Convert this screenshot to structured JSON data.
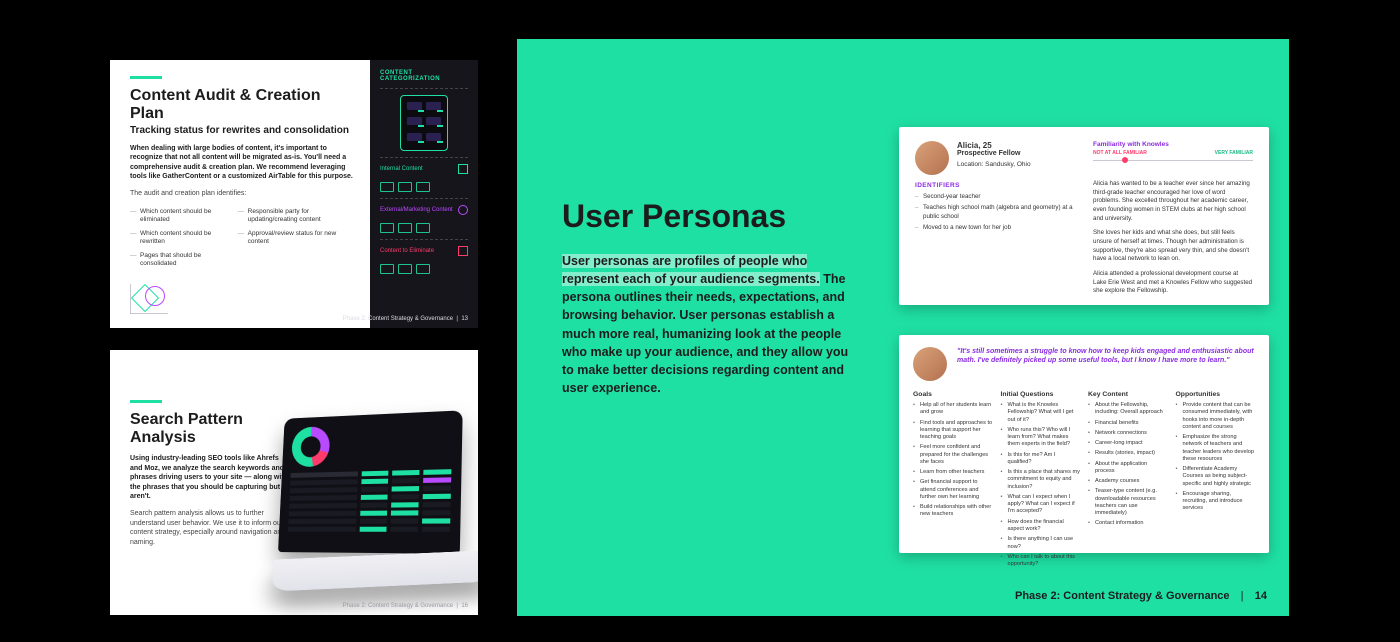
{
  "audit": {
    "title": "Content Audit & Creation Plan",
    "subtitle": "Tracking status for rewrites and consolidation",
    "lead": "When dealing with large bodies of content, it's important to recognize that not all content will be migrated as-is. You'll need a comprehensive audit & creation plan. We recommend leveraging tools like GatherContent or a customized AirTable for this purpose.",
    "intro": "The audit and creation plan identifies:",
    "col1": [
      "Which content should be eliminated",
      "Which content should be rewritten",
      "Pages that should be consolidated"
    ],
    "col2": [
      "Responsible party for updating/creating content",
      "Approval/review status for new content"
    ],
    "cat_title": "CONTENT CATEGORIZATION",
    "rows": {
      "internal": "Internal Content",
      "external": "External/Marketing Content",
      "eliminate": "Content to Eliminate"
    },
    "footer_phase": "Phase 2: Content Strategy & Governance",
    "footer_page": "13"
  },
  "search": {
    "title": "Search Pattern Analysis",
    "lead": "Using industry-leading SEO tools like Ahrefs and Moz, we analyze the search keywords and phrases driving users to your site — along with the phrases that you should be capturing but aren't.",
    "more": "Search pattern analysis allows us to further understand user behavior. We use it to inform our content strategy, especially around navigation and naming.",
    "footer_phase": "Phase 2: Content Strategy & Governance",
    "footer_page": "16"
  },
  "personas": {
    "title": "User Personas",
    "body_hl": "User personas are profiles of people who represent each of your audience segments.",
    "body_rest": " The persona outlines their needs, expectations, and browsing behavior. User personas establish a much more real, humanizing look at the people who make up your audience, and they allow you to make better decisions regarding content and user experience.",
    "footer_phase": "Phase 2: Content Strategy & Governance",
    "footer_page": "14",
    "top": {
      "name": "Alicia, 25",
      "role": "Prospective Fellow",
      "location": "Location: Sandusky, Ohio",
      "familiar_label": "Familiarity with Knowles",
      "slider_left": "NOT AT ALL FAMILIAR",
      "slider_right": "VERY FAMILIAR",
      "identifiers_heading": "IDENTIFIERS",
      "identifiers": [
        "Second-year teacher",
        "Teaches high school math (algebra and geometry) at a public school",
        "Moved to a new town for her job"
      ],
      "bio": [
        "Alicia has wanted to be a teacher ever since her amazing third-grade teacher encouraged her love of word problems. She excelled throughout her academic career, even founding women in STEM clubs at her high school and university.",
        "She loves her kids and what she does, but still feels unsure of herself at times. Though her administration is supportive, they're also spread very thin, and she doesn't have a local network to lean on.",
        "Alicia attended a professional development course at Lake Erie West and met a Knowles Fellow who suggested she explore the Fellowship."
      ]
    },
    "bottom": {
      "quote": "\"It's still sometimes a struggle to know how to keep kids engaged and enthusiastic about math. I've definitely picked up some useful tools, but I know I have more to learn.\"",
      "columns": [
        {
          "heading": "Goals",
          "items": [
            "Help all of her students learn and grow",
            "Find tools and approaches to learning that support her teaching goals",
            "Feel more confident and prepared for the challenges she faces",
            "Learn from other teachers",
            "Get financial support to attend conferences and further own her learning",
            "Build relationships with other new teachers"
          ]
        },
        {
          "heading": "Initial Questions",
          "items": [
            "What is the Knowles Fellowship? What will I get out of it?",
            "Who runs this? Who will I learn from? What makes them experts in the field?",
            "Is this for me? Am I qualified?",
            "Is this a place that shares my commitment to equity and inclusion?",
            "What can I expect when I apply? What can I expect if I'm accepted?",
            "How does the financial aspect work?",
            "Is there anything I can use now?",
            "Who can I talk to about this opportunity?"
          ]
        },
        {
          "heading": "Key Content",
          "items": [
            "About the Fellowship, including: Overall approach",
            "Financial benefits",
            "Network connections",
            "Career-long impact",
            "Results (stories, impact)",
            "About the application process",
            "Academy courses",
            "Teaser-type content (e.g. downloadable resources teachers can use immediately)",
            "Contact information"
          ]
        },
        {
          "heading": "Opportunities",
          "items": [
            "Provide content that can be consumed immediately, with hooks into more in-depth content and courses",
            "Emphasize the strong network of teachers and teacher leaders who develop these resources",
            "Differentiate Academy Courses as being subject-specific and highly strategic",
            "Encourage sharing, recruiting, and introduce services"
          ]
        }
      ]
    }
  }
}
